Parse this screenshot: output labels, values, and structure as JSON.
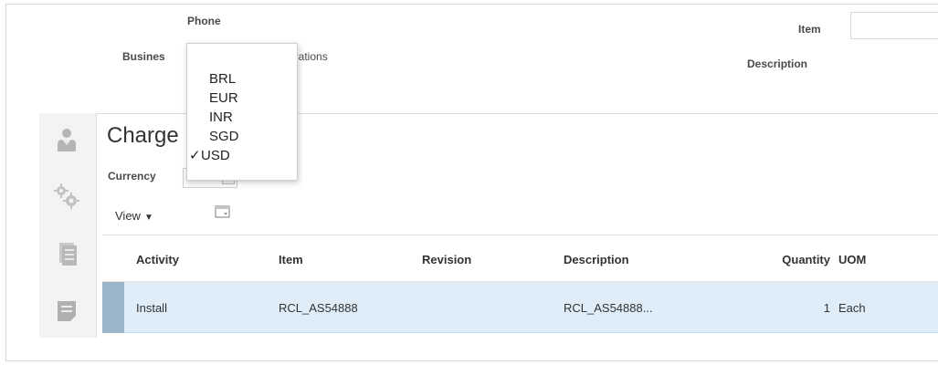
{
  "header": {
    "phone_label": "Phone",
    "business_label": "Busines",
    "business_value": "Operations",
    "item_label": "Item",
    "item_value": "",
    "description_label": "Description"
  },
  "sidebar": {
    "items": [
      {
        "icon": "person-icon"
      },
      {
        "icon": "gears-icon"
      },
      {
        "icon": "documents-icon"
      },
      {
        "icon": "note-icon"
      }
    ]
  },
  "charges": {
    "title": "Charge",
    "currency_label": "Currency",
    "currency_value": "USD",
    "view_label": "View",
    "columns": [
      "Activity",
      "Item",
      "Revision",
      "Description",
      "Quantity",
      "UOM"
    ],
    "rows": [
      {
        "activity": "Install",
        "item": "RCL_AS54888",
        "revision": "",
        "description": "RCL_AS54888...",
        "quantity": "1",
        "uom": "Each"
      }
    ]
  },
  "currency_dropdown": {
    "options": [
      "BRL",
      "EUR",
      "INR",
      "SGD",
      "USD"
    ],
    "selected": "USD",
    "check_glyph": "✓"
  },
  "colors": {
    "row_selected_bg": "#deedf8",
    "row_selector": "#9cb4c8",
    "sidebar_bg": "#f3f3f3"
  }
}
